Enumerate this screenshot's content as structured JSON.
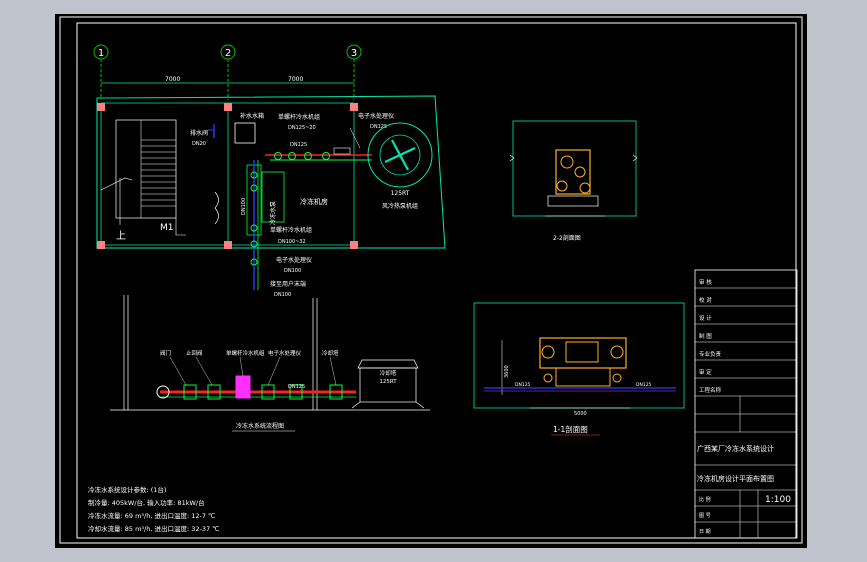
{
  "colors": {
    "background": "#bfc4cc",
    "drawing_bg": "#000000",
    "frame": "#ffffff",
    "wall": "#00e8b0",
    "grid": "#00c000",
    "pipe_red": "#ff2020",
    "pipe_green": "#00ff40",
    "pipe_blue": "#2040ff",
    "equipment": "#ffb020",
    "magenta": "#ff30ff",
    "note": "#ffff40"
  },
  "grid_axes": [
    "1",
    "2",
    "3"
  ],
  "dimensions": [
    "7000",
    "7000"
  ],
  "plan_labels": {
    "water_tank": "补水水箱",
    "make_up_inlet": "排水阀",
    "make_up_size": "DN20",
    "valve_top": "单螺杆冷水机组",
    "valve_top_size": "DN125~20",
    "electronic_top": "电子水处理仪",
    "electronic_top_size": "DN125",
    "pipe_size_mid": "DN125",
    "fan_name": "风冷热泵机组",
    "fan_spec": "125RT",
    "room_name": "冷冻机房",
    "pump_group": "冷冻水泵",
    "valve_bottom": "单螺杆冷水机组",
    "valve_bottom_size": "DN100~32",
    "electronic_bottom": "电子水处理仪",
    "electronic_bottom_size": "DN100",
    "to_floor": "接至用户末端",
    "to_floor_size": "DN100",
    "stair_label": "上",
    "door_label": "M1",
    "pipe_v_size": "DN100"
  },
  "elevation_labels": {
    "l1": "阀门",
    "l2": "止回阀",
    "l3": "单螺杆冷水机组",
    "l4": "电子水处理仪",
    "l5": "冷却塔",
    "tower": "冷却塔",
    "tower_spec": "125RT",
    "pipe_size": "DN125",
    "title": "冷冻水系统流程图"
  },
  "section_labels": {
    "small_title": "2-2剖面图",
    "big_title": "1-1剖面图",
    "left_dim": "3600",
    "bottom_dim": "5000",
    "pipe_a": "DN125",
    "pipe_b": "DN125"
  },
  "notes": [
    "冷冻水系统设计参数: (1台)",
    "制冷量: 405kW/台, 输入功率: 81kW/台",
    "冷冻水流量: 69 m³/h, 进出口温度: 12-7 ℃",
    "冷却水流量: 85 m³/h, 进出口温度: 32-37 ℃"
  ],
  "title_block": {
    "rows_left": [
      "审 核",
      "校 对",
      "设 计",
      "制 图",
      "专业负责",
      "审 定",
      "工程名称"
    ],
    "project_name": "广西某厂冷冻水系统设计",
    "drawing_name": "冷冻机房设计平面布置图",
    "scale_label": "比 例",
    "scale": "1:100",
    "drawing_no_label": "图 号",
    "date_label": "日 期"
  }
}
